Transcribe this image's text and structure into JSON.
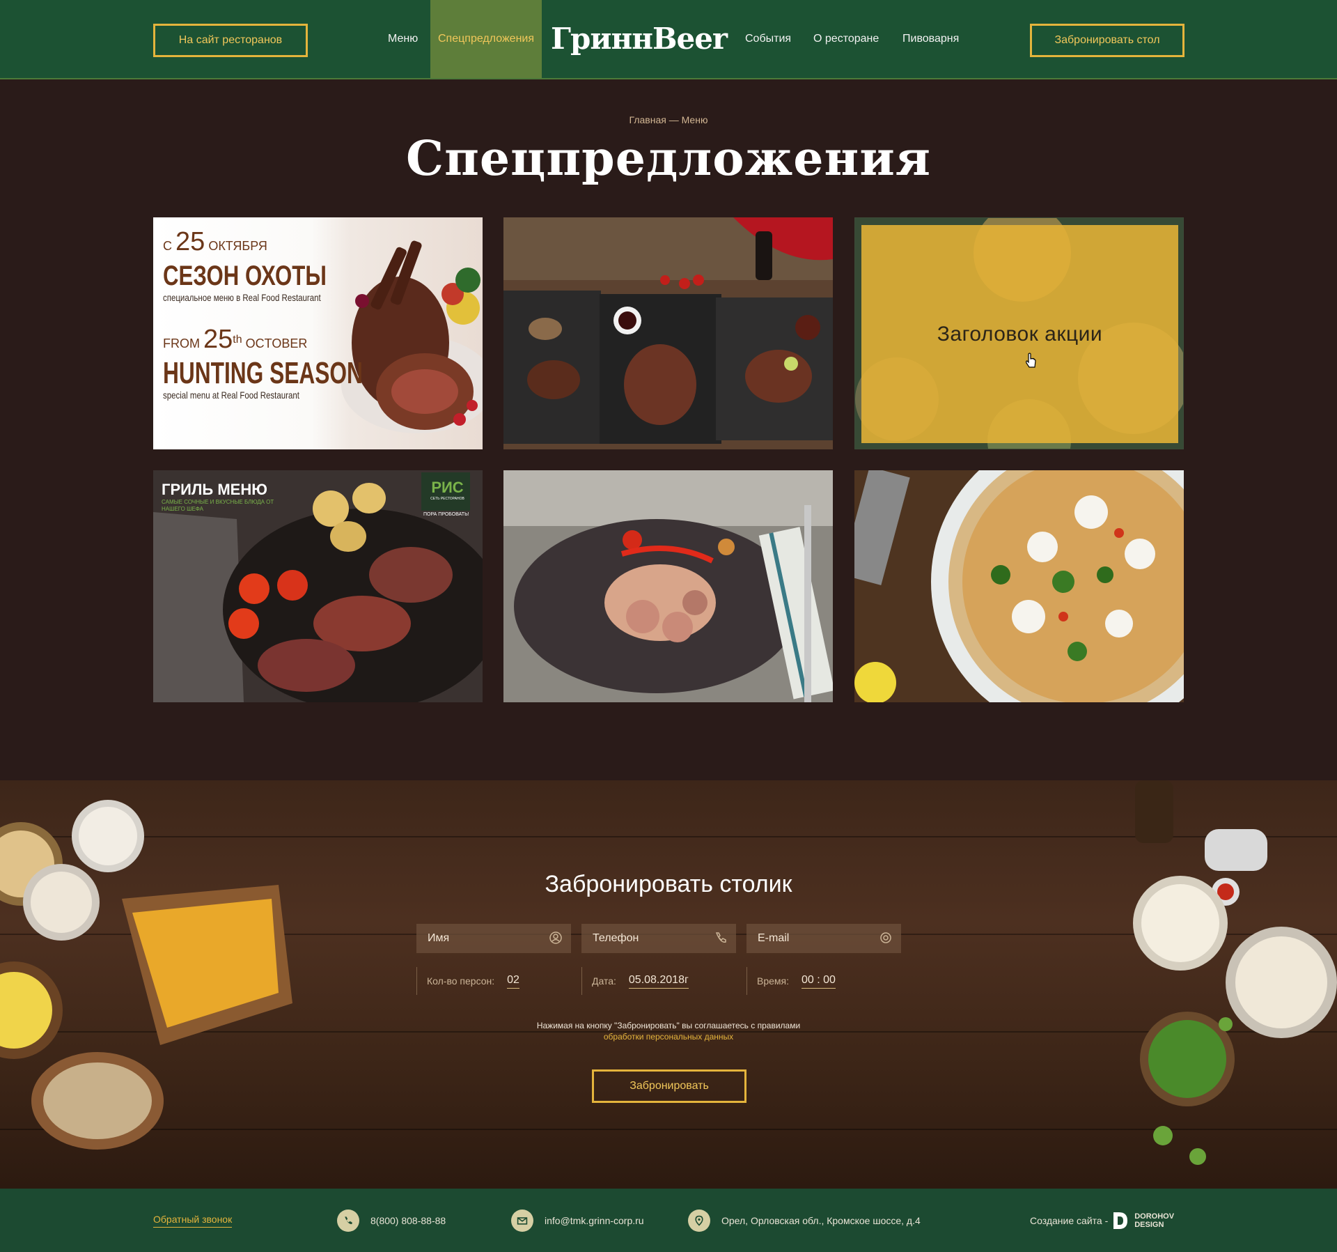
{
  "header": {
    "restaurants_button": "На сайт ресторанов",
    "nav_left": [
      {
        "label": "Меню"
      },
      {
        "label": "Спецпредложения"
      }
    ],
    "logo": "ГриннBeer",
    "nav_right": [
      {
        "label": "События"
      },
      {
        "label": "О ресторане"
      },
      {
        "label": "Пивоварня"
      }
    ],
    "book_button": "Забронировать стол",
    "colors": {
      "header_bg": "#1c5233",
      "accent": "#e4b43c",
      "active_nav": "#5e7e3a"
    }
  },
  "hero": {
    "breadcrumb": "Главная — Меню",
    "title": "Спецпредложения"
  },
  "cards": [
    {
      "type": "hunting",
      "lines": {
        "from_ru_prefix": "С",
        "from_ru_num": "25",
        "from_ru_month": "ОКТЯБРЯ",
        "title_ru": "СЕЗОН ОХОТЫ",
        "sub_ru": "специальное меню в Real Food Restaurant",
        "from_en_prefix": "FROM",
        "from_en_num": "25",
        "from_en_sup": "th",
        "from_en_month": "OCTOBER",
        "title_en": "HUNTING SEASON",
        "sub_en": "special menu at Real Food Restaurant"
      }
    },
    {
      "type": "steaks"
    },
    {
      "type": "hover",
      "overlay_title": "Заголовок акции"
    },
    {
      "type": "grill",
      "lines": {
        "title": "ГРИЛЬ МЕНЮ",
        "sub": "САМЫЕ СОЧНЫЕ И ВКУСНЫЕ БЛЮДА ОТ НАШЕГО ШЕФА",
        "brand": "РИС",
        "brand_sub": "СЕТЬ РЕСТОРАНОВ",
        "tag": "ПОРА ПРОБОВАТЬ!"
      }
    },
    {
      "type": "octopus"
    },
    {
      "type": "pizza"
    }
  ],
  "reservation": {
    "title": "Забронировать столик",
    "fields": [
      {
        "label": "Имя",
        "icon": "user-icon"
      },
      {
        "label": "Телефон",
        "icon": "phone-icon"
      },
      {
        "label": "E-mail",
        "icon": "at-icon"
      }
    ],
    "persons_label": "Кол-во персон:",
    "persons_value": "02",
    "date_label": "Дата:",
    "date_value": "05.08.2018г",
    "time_label": "Время:",
    "time_value": "00 : 00",
    "consent_text": "Нажимая на кнопку \"Забронировать\" вы соглашаетесь с правилами",
    "consent_link": "обработки персональных данных",
    "submit": "Забронировать"
  },
  "footer": {
    "callback": "Обратный звонок",
    "phone": "8(800) 808-88-88",
    "email": "info@tmk.grinn-corp.ru",
    "address": "Орел, Орловская обл., Кромское шоссе, д.4",
    "credit": "Создание сайта -",
    "credit_brand_1": "DOROHOV",
    "credit_brand_2": "DESIGN"
  }
}
